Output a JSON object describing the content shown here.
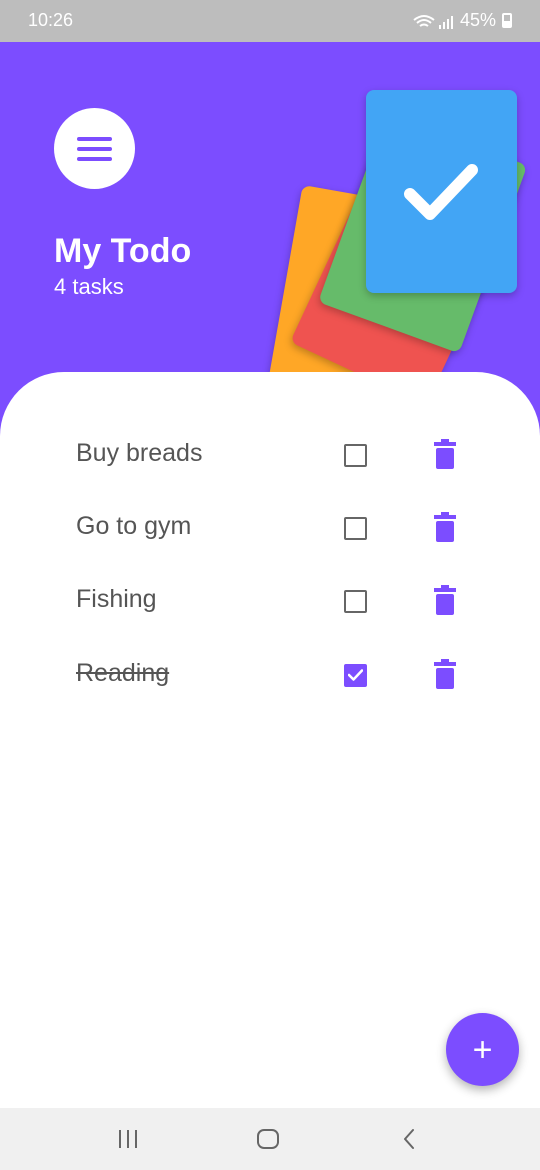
{
  "status_bar": {
    "time": "10:26",
    "battery": "45%"
  },
  "header": {
    "title": "My Todo",
    "subtitle": "4 tasks"
  },
  "tasks": [
    {
      "text": "Buy breads",
      "done": false
    },
    {
      "text": "Go to gym",
      "done": false
    },
    {
      "text": "Fishing",
      "done": false
    },
    {
      "text": "Reading",
      "done": true
    }
  ],
  "fab": {
    "label": "+"
  },
  "icons": {
    "menu": "menu-icon",
    "delete": "trash-icon",
    "add": "plus-icon",
    "checkbox": "checkbox-icon"
  },
  "colors": {
    "accent": "#7c4dff",
    "header_bg": "#7c4dff",
    "card_orange": "#ffa726",
    "card_red": "#ef5350",
    "card_green": "#66bb6a",
    "card_blue": "#42a5f5",
    "text": "#555555"
  }
}
